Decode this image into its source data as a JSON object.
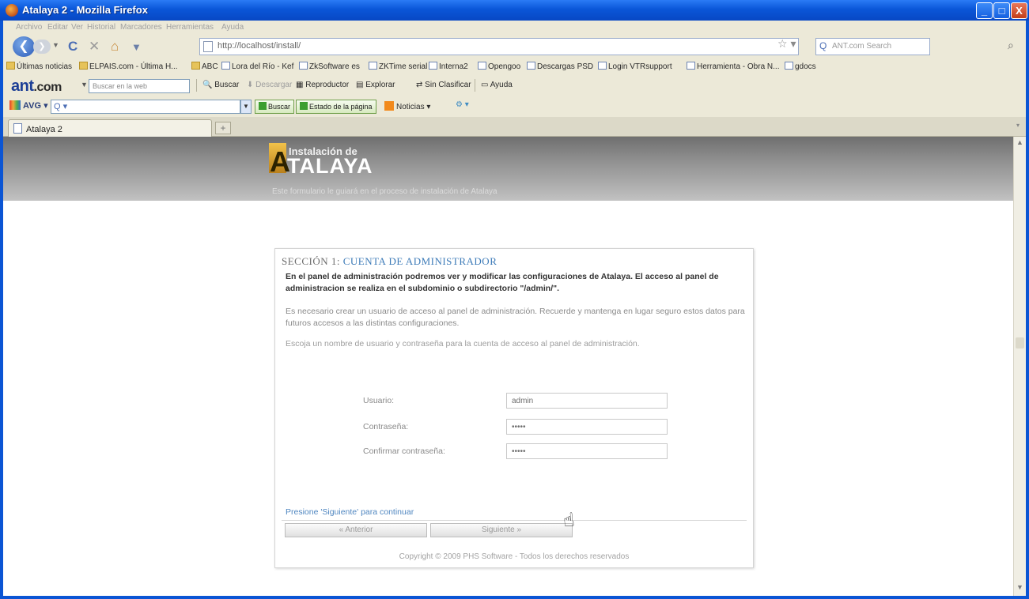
{
  "window": {
    "title": "Atalaya 2 - Mozilla Firefox",
    "controls": {
      "minimize": "_",
      "maximize": "□",
      "close": "X"
    }
  },
  "menu": [
    "Archivo",
    "Editar",
    "Ver",
    "Historial",
    "Marcadores",
    "Herramientas",
    "Ayuda"
  ],
  "nav": {
    "back_glyph": "❮",
    "forward_glyph": "❯",
    "reload_glyph": "C",
    "stop_glyph": "✕",
    "home_glyph": "⌂",
    "url": "http://localhost/install/",
    "search_placeholder": "ANT.com Search",
    "search_engine_icon": "search-icon"
  },
  "bookmarks": [
    {
      "label": "Últimas noticias",
      "icon": "folder"
    },
    {
      "label": "ELPAIS.com - Última H...",
      "icon": "folder"
    },
    {
      "label": "ABC",
      "icon": "folder"
    },
    {
      "label": "Lora del Río - Kef",
      "icon": "page"
    },
    {
      "label": "ZkSoftware es",
      "icon": "page"
    },
    {
      "label": "ZKTime serial",
      "icon": "page"
    },
    {
      "label": "Interna2",
      "icon": "page"
    },
    {
      "label": "Opengoo",
      "icon": "page"
    },
    {
      "label": "Descargas PSD",
      "icon": "page"
    },
    {
      "label": "Login VTRsupport",
      "icon": "page"
    },
    {
      "label": "Herramienta - Obra N...",
      "icon": "page"
    },
    {
      "label": "gdocs",
      "icon": "page"
    }
  ],
  "ant_toolbar": {
    "logo": "ant",
    "logo_suffix": ".com",
    "search_placeholder": "Buscar en la web",
    "items": [
      {
        "label": "Buscar",
        "dim": false
      },
      {
        "label": "Descargar",
        "dim": true
      },
      {
        "label": "Reproductor",
        "dim": false
      },
      {
        "label": "Explorar",
        "dim": false
      },
      {
        "label": "Sin Clasificar",
        "dim": false
      },
      {
        "label": "Ayuda",
        "dim": false
      }
    ]
  },
  "avg_toolbar": {
    "logo": "AVG",
    "search_button": "Buscar",
    "page_status": "Estado de la página",
    "news": "Noticias"
  },
  "tabs": [
    {
      "label": "Atalaya 2",
      "active": true
    }
  ],
  "page": {
    "logo_top": "Instalación de",
    "logo_main": "TALAYA",
    "logo_initial": "A",
    "banner_subtitle": "Este formulario le guiará en el proceso de instalación de Atalaya",
    "section_prefix": "SECCIÓN 1: ",
    "section_title": "CUENTA DE ADMINISTRADOR",
    "intro": "En el panel de administración podremos ver y modificar las configuraciones de Atalaya. El acceso al panel de administracion se realiza en el subdominio o subdirectorio \"/admin/\".",
    "paragraph2": "Es necesario crear un usuario de acceso al panel de administración. Recuerde y mantenga en lugar seguro estos datos para futuros accesos a las distintas configuraciones.",
    "paragraph3": "Escoja un nombre de usuario y contraseña para la cuenta de acceso al panel de administración.",
    "form": {
      "user_label": "Usuario:",
      "user_value": "admin",
      "password_label": "Contraseña:",
      "password_value": "•••••",
      "confirm_label": "Confirmar contraseña:",
      "confirm_value": "•••••"
    },
    "hint": "Presione 'Siguiente' para continuar",
    "prev_button": "« Anterior",
    "next_button": "Siguiente »",
    "copyright": "Copyright © 2009 PHS Software - Todos los derechos reservados"
  }
}
